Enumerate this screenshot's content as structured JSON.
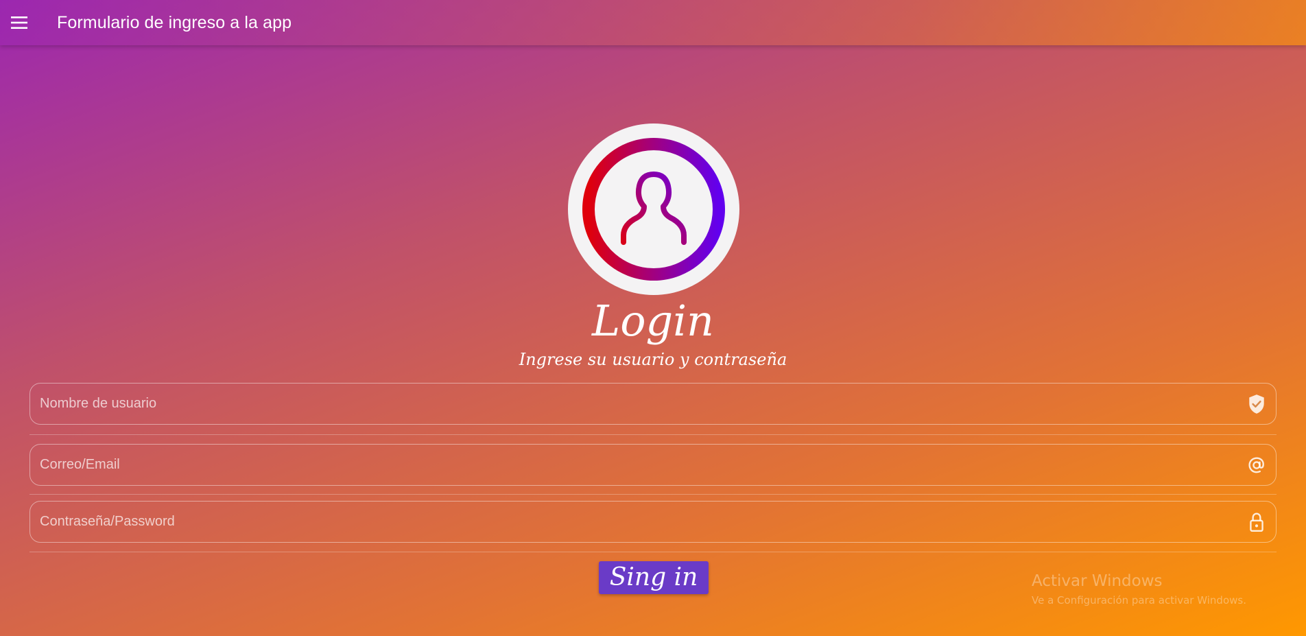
{
  "app_bar": {
    "title": "Formulario de ingreso a la app",
    "menu_icon": "hamburger-menu-icon"
  },
  "login": {
    "avatar_icon": "user-avatar-icon",
    "title": "Login",
    "subtitle": "Ingrese su usuario y contraseña"
  },
  "form": {
    "username": {
      "placeholder": "Nombre de usuario",
      "value": "",
      "icon": "shield-check-icon"
    },
    "email": {
      "placeholder": "Correo/Email",
      "value": "",
      "icon": "at-sign-icon"
    },
    "password": {
      "placeholder": "Contraseña/Password",
      "value": "",
      "icon": "lock-icon"
    },
    "submit_label": "Sing in"
  },
  "windows_watermark": {
    "title": "Activar Windows",
    "subtitle": "Ve a Configuración para activar Windows."
  },
  "colors": {
    "gradient_start": "#9c27b0",
    "gradient_end": "#ff9800",
    "button": "#6a3bc7",
    "avatar_ring_start": "#e0000b",
    "avatar_ring_end": "#6200ee"
  }
}
